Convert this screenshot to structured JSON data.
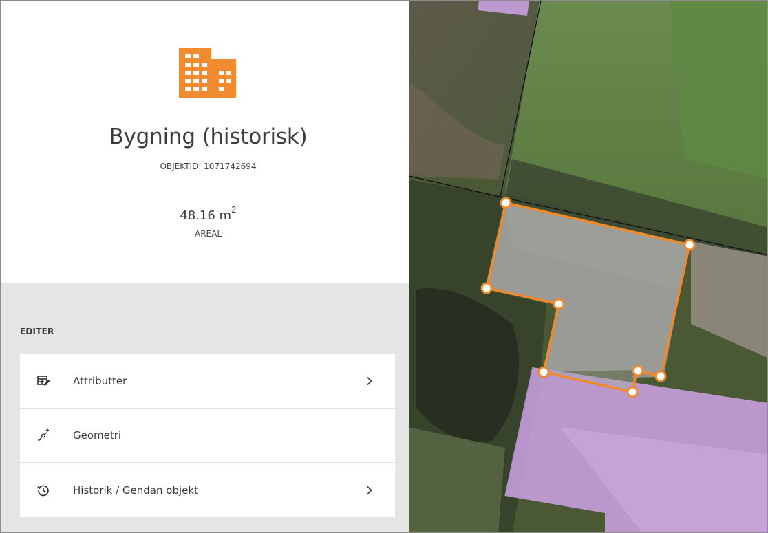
{
  "feature": {
    "icon": "building-icon",
    "title": "Bygning (historisk)",
    "object_id_text": "OBJEKTID: 1071742694",
    "area_value": "48.16 m",
    "area_unit_sup": "2",
    "area_label": "AREAL"
  },
  "edit": {
    "heading": "EDITER",
    "items": [
      {
        "label": "Attributter",
        "icon": "table-edit-icon",
        "chevron": true
      },
      {
        "label": "Geometri",
        "icon": "geometry-vertex-icon",
        "chevron": false
      },
      {
        "label": "Historik / Gendan objekt",
        "icon": "history-restore-icon",
        "chevron": true
      }
    ]
  },
  "colors": {
    "accent": "#F28A30",
    "selection_outline": "#F08A2C",
    "building_fill": "#C9A0E0",
    "panel_gray": "#E5E5E5"
  },
  "map": {
    "layers": [
      "aerial-imagery",
      "parcel-boundaries",
      "buildings",
      "selected-building"
    ]
  }
}
